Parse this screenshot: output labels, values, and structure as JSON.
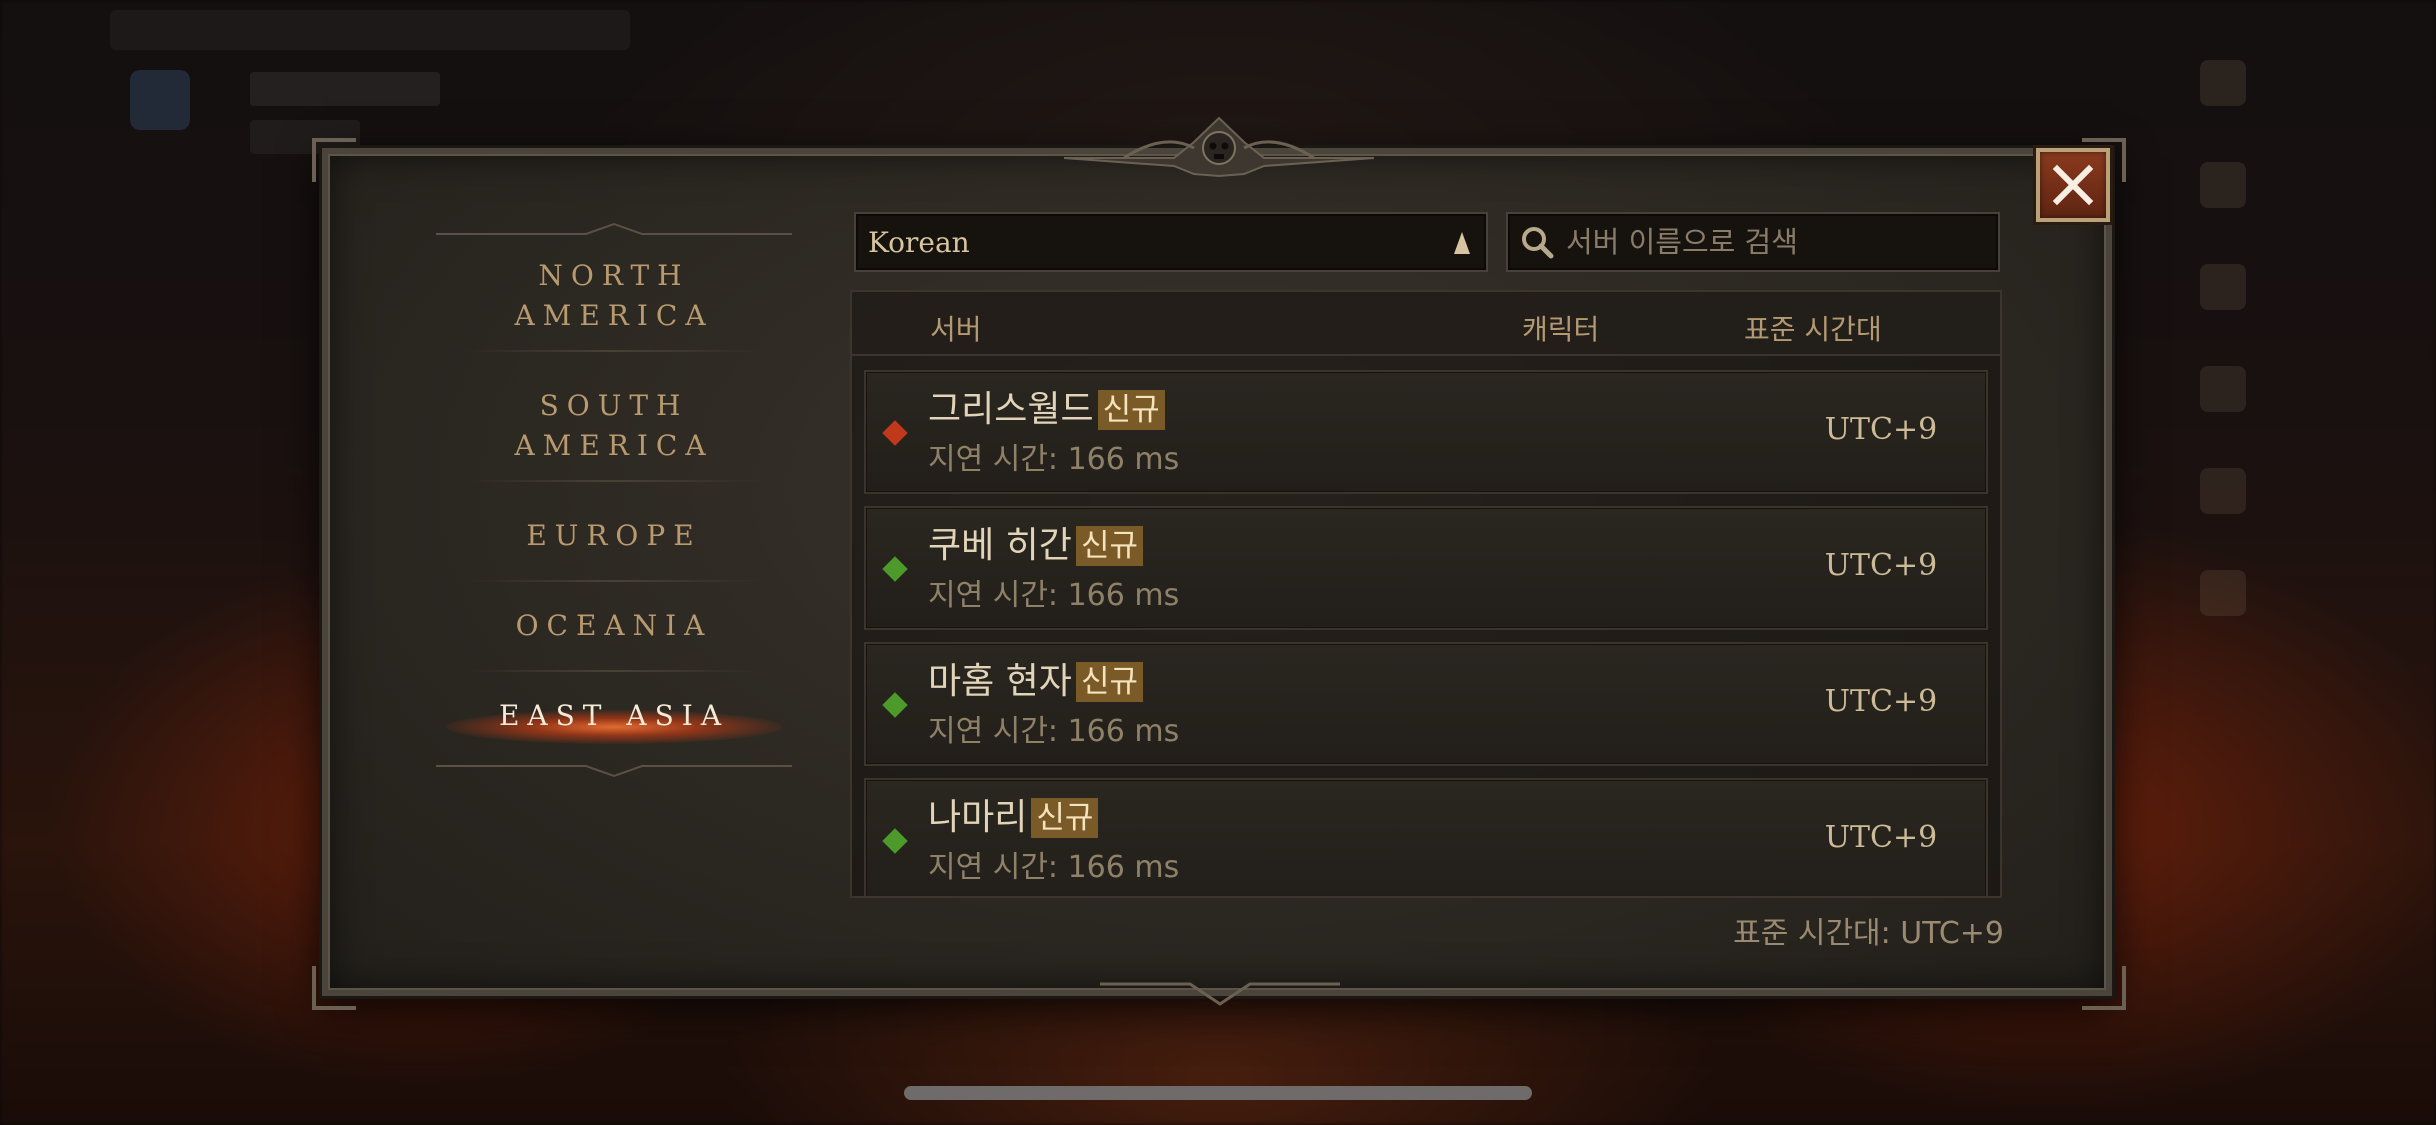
{
  "dialog": {
    "close_icon": "close-icon"
  },
  "regions": [
    {
      "label_line1": "NORTH",
      "label_line2": "AMERICA",
      "active": false
    },
    {
      "label_line1": "SOUTH",
      "label_line2": "AMERICA",
      "active": false
    },
    {
      "label_line1": "EUROPE",
      "label_line2": "",
      "active": false
    },
    {
      "label_line1": "OCEANIA",
      "label_line2": "",
      "active": false
    },
    {
      "label_line1": "EAST ASIA",
      "label_line2": "",
      "active": true
    }
  ],
  "language_select": {
    "selected": "Korean"
  },
  "search": {
    "placeholder": "서버 이름으로 검색"
  },
  "table": {
    "headers": {
      "server": "서버",
      "character": "캐릭터",
      "timezone": "표준 시간대"
    },
    "rows": [
      {
        "name": "그리스월드",
        "badge": "신규",
        "latency": "지연 시간: 166 ms",
        "timezone": "UTC+9",
        "status_color": "#c0391b"
      },
      {
        "name": "쿠베 히간",
        "badge": "신규",
        "latency": "지연 시간: 166 ms",
        "timezone": "UTC+9",
        "status_color": "#4c9a2a"
      },
      {
        "name": "마홈 현자",
        "badge": "신규",
        "latency": "지연 시간: 166 ms",
        "timezone": "UTC+9",
        "status_color": "#4c9a2a"
      },
      {
        "name": "나마리",
        "badge": "신규",
        "latency": "지연 시간: 166 ms",
        "timezone": "UTC+9",
        "status_color": "#4c9a2a"
      }
    ]
  },
  "footer": {
    "timezone_text": "표준 시간대: UTC+9"
  },
  "colors": {
    "accent": "#b89a6e",
    "active_glow": "#e36a2e",
    "badge_bg": "#7a5a26"
  }
}
